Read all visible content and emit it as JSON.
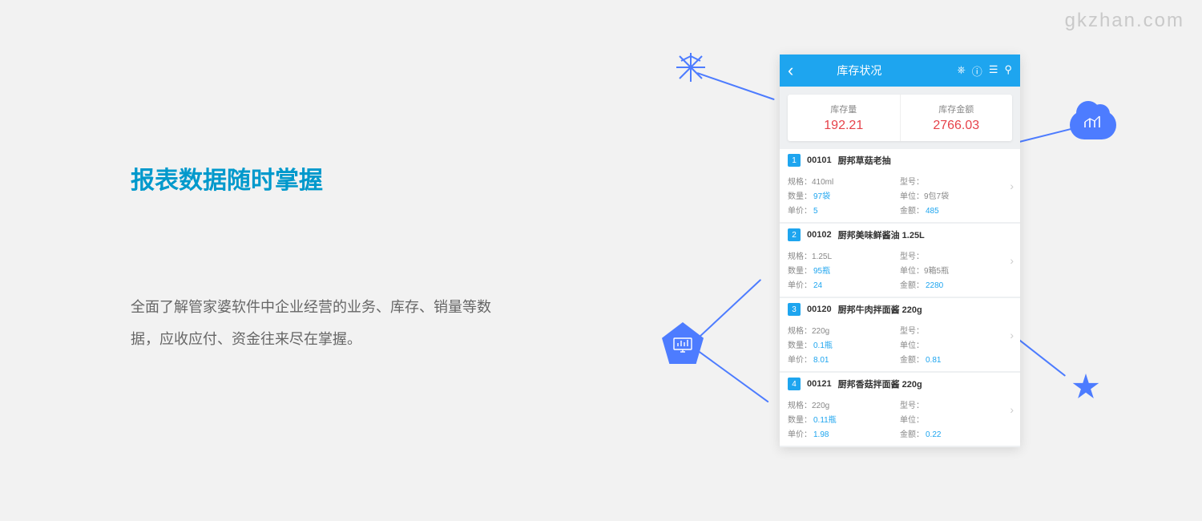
{
  "watermark": "gkzhan.com",
  "headline": "报表数据随时掌握",
  "description": "全面了解管家婆软件中企业经营的业务、库存、销量等数据，应收应付、资金往来尽在掌握。",
  "app": {
    "title": "库存状况",
    "summary": [
      {
        "label": "库存量",
        "value": "192.21"
      },
      {
        "label": "库存金额",
        "value": "2766.03"
      }
    ],
    "field_labels": {
      "spec": "规格：",
      "model": "型号：",
      "qty": "数量：",
      "unit": "单位：",
      "price": "单价：",
      "amount": "金额："
    },
    "items": [
      {
        "idx": "1",
        "code": "00101",
        "name": "厨邦草菇老抽",
        "spec": "410ml",
        "model": "",
        "qty": "97袋",
        "unit": "9包7袋",
        "price": "5",
        "amount": "485"
      },
      {
        "idx": "2",
        "code": "00102",
        "name": "厨邦美味鲜酱油 1.25L",
        "spec": "1.25L",
        "model": "",
        "qty": "95瓶",
        "unit": "9箱5瓶",
        "price": "24",
        "amount": "2280"
      },
      {
        "idx": "3",
        "code": "00120",
        "name": "厨邦牛肉拌面酱 220g",
        "spec": "220g",
        "model": "",
        "qty": "0.1瓶",
        "unit": "",
        "price": "8.01",
        "amount": "0.81"
      },
      {
        "idx": "4",
        "code": "00121",
        "name": "厨邦香菇拌面酱 220g",
        "spec": "220g",
        "model": "",
        "qty": "0.11瓶",
        "unit": "",
        "price": "1.98",
        "amount": "0.22"
      }
    ]
  }
}
